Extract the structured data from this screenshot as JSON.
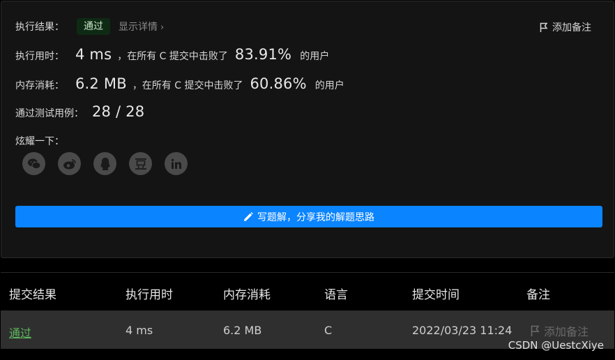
{
  "result": {
    "label": "执行结果：",
    "status": "通过",
    "details": "显示详情",
    "add_note": "添加备注"
  },
  "time": {
    "label": "执行用时：",
    "value": "4 ms",
    "mid": "，在所有 C 提交中击败了",
    "pct": "83.91%",
    "tail": "的用户"
  },
  "memory": {
    "label": "内存消耗：",
    "value": "6.2 MB",
    "mid": "，在所有 C 提交中击败了",
    "pct": "60.86%",
    "tail": "的用户"
  },
  "tests": {
    "label": "通过测试用例：",
    "value": "28 / 28"
  },
  "share": {
    "label": "炫耀一下：",
    "icons": [
      "wechat-icon",
      "weibo-icon",
      "qq-icon",
      "douban-icon",
      "linkedin-icon"
    ]
  },
  "write_solution": "写题解，分享我的解题思路",
  "table": {
    "headers": [
      "提交结果",
      "执行用时",
      "内存消耗",
      "语言",
      "提交时间",
      "备注"
    ],
    "row": {
      "result": "通过",
      "time": "4 ms",
      "memory": "6.2 MB",
      "language": "C",
      "submitted": "2022/03/23 11:24",
      "note": "添加备注"
    }
  },
  "watermark": "CSDN @UestcXiye",
  "colors": {
    "accent": "#0a84ff",
    "success": "#5cb85c",
    "panel": "#141414"
  }
}
